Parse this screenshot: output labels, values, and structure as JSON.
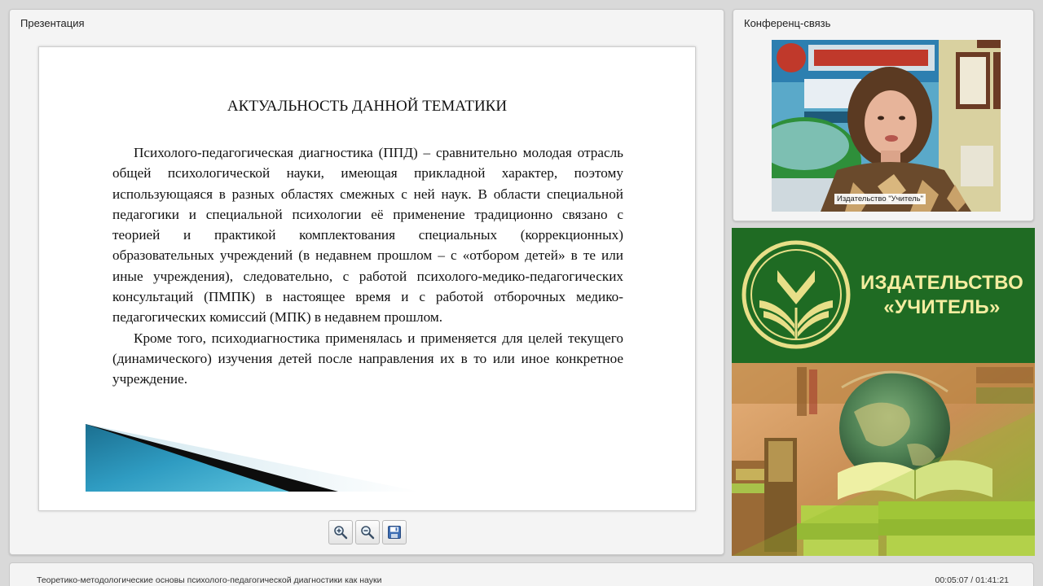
{
  "presentation_panel": {
    "title": "Презентация"
  },
  "slide": {
    "title": "АКТУАЛЬНОСТЬ ДАННОЙ ТЕМАТИКИ",
    "paragraphs": [
      "Психолого-педагогическая диагностика (ППД) – сравнительно молодая отрасль общей психологической науки, имеющая прикладной характер, поэтому использующаяся в разных областях смежных с ней наук. В области специальной педагогики и специальной психологии её применение традиционно связано с теорией и практикой комплектования специальных (коррекционных) образовательных учреждений (в недавнем прошлом – с «отбором детей» в те или иные учреждения), следовательно, с работой психолого-медико-педагогических консультаций (ПМПК) в настоящее время и с работой отборочных медико- педагогических комиссий (МПК) в недавнем прошлом.",
      "Кроме того, психодиагностика применялась и применяется для целей текущего (динамического) изучения детей после направления их в то или иное конкретное учреждение."
    ]
  },
  "toolbar": {
    "zoom_in_icon": "zoom-in-icon",
    "zoom_out_icon": "zoom-out-icon",
    "save_icon": "save-icon"
  },
  "conference_panel": {
    "title": "Конференц-связь",
    "video_caption": "Издательство \"Учитель\""
  },
  "ad_banner": {
    "line1": "ИЗДАТЕЛЬСТВО",
    "line2": "«УЧИТЕЛЬ»"
  },
  "footer": {
    "lecture_title": "Теоретико-методологические основы психолого-педагогической диагностики как науки",
    "time": "00:05:07 / 01:41:21"
  },
  "colors": {
    "ad_green": "#1f6b23",
    "ad_text": "#f4eda0"
  }
}
